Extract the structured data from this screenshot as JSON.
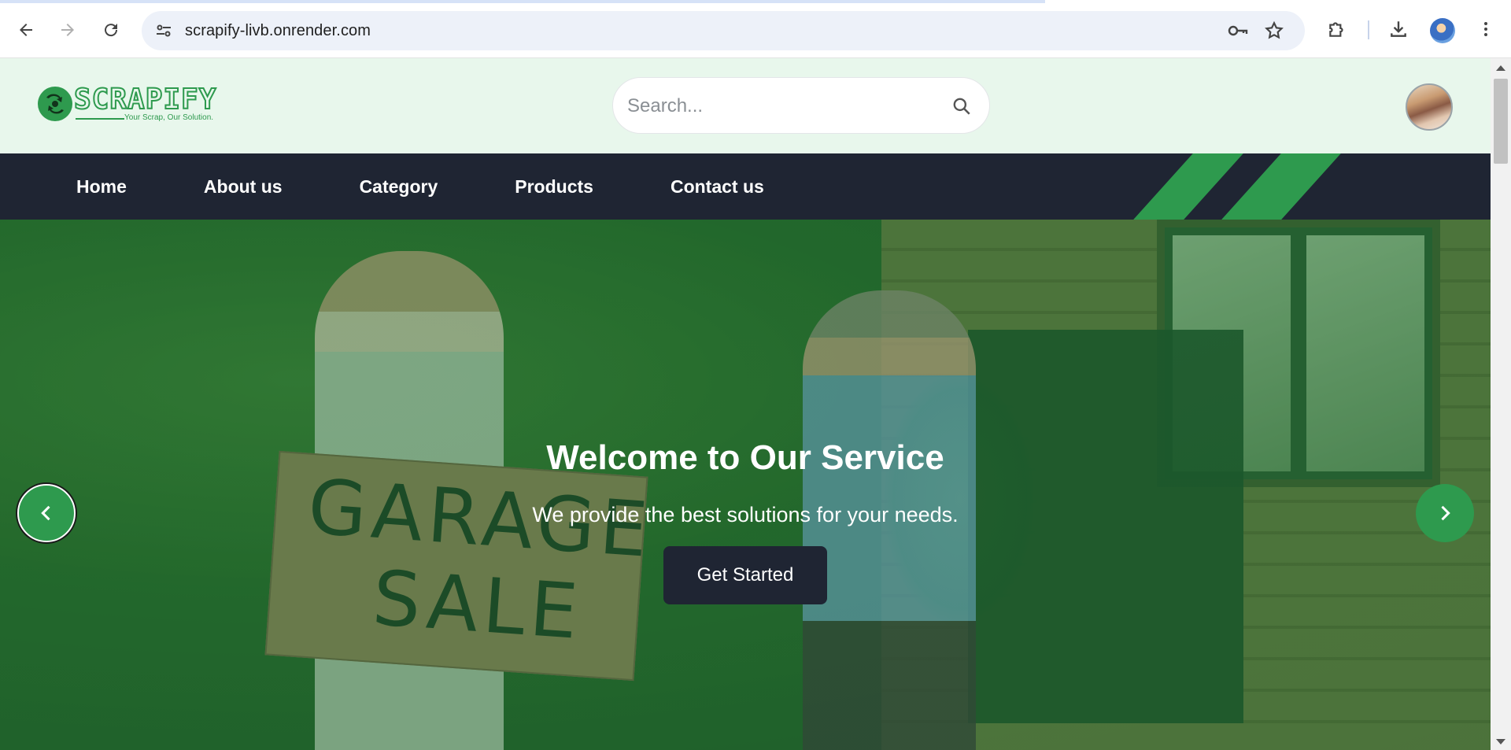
{
  "browser": {
    "url": "scrapify-livb.onrender.com",
    "icons": [
      "back-icon",
      "forward-icon",
      "reload-icon",
      "site-settings-icon",
      "password-key-icon",
      "bookmark-star-icon",
      "extensions-icon",
      "download-icon",
      "profile-icon",
      "more-menu-icon"
    ]
  },
  "header": {
    "logo_text": "SCRAPIFY",
    "tagline": "Your Scrap, Our Solution.",
    "search_placeholder": "Search..."
  },
  "nav": {
    "items": [
      {
        "label": "Home"
      },
      {
        "label": "About us"
      },
      {
        "label": "Category"
      },
      {
        "label": "Products"
      },
      {
        "label": "Contact us"
      }
    ]
  },
  "hero": {
    "title": "Welcome to Our Service",
    "subtitle": "We provide the best solutions for your needs.",
    "cta_label": "Get Started",
    "sign_line1": "GARAGE",
    "sign_line2": "SALE"
  },
  "colors": {
    "brand_green": "#2e9a4e",
    "header_bg": "#e8f7ec",
    "nav_bg": "#1f2533"
  }
}
